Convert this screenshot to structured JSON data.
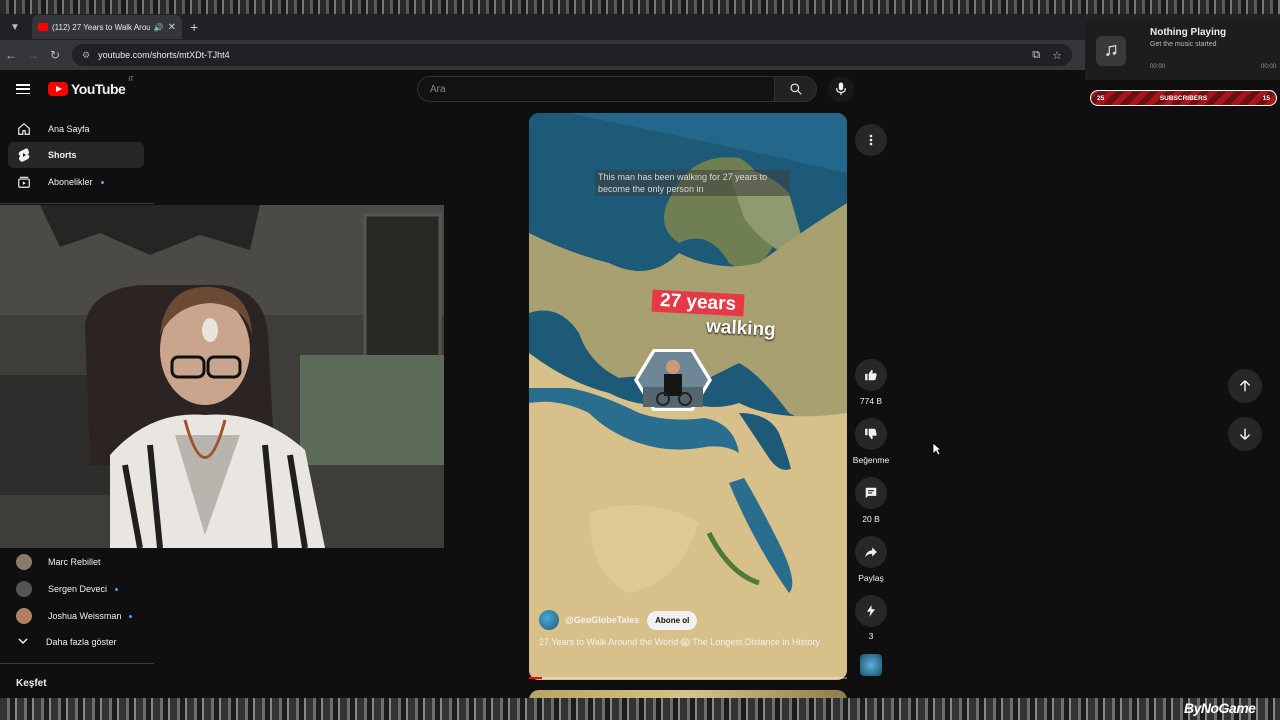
{
  "browser": {
    "tab_title": "(112) 27 Years to Walk Arou",
    "url": "youtube.com/shorts/mtXDt-TJht4"
  },
  "youtube": {
    "logo_text": "YouTube",
    "region": "IT",
    "search_placeholder": "Ara"
  },
  "sidebar": {
    "home": "Ana Sayfa",
    "shorts": "Shorts",
    "subscriptions": "Abonelikler",
    "subs": [
      {
        "name": "Marc Rebillet",
        "color": "#8a7a6a"
      },
      {
        "name": "Sergen Deveci",
        "color": "#555555"
      },
      {
        "name": "Joshua Weissman",
        "color": "#b08060"
      }
    ],
    "show_more": "Daha fazla göster",
    "explore": "Keşfet"
  },
  "short": {
    "caption": "This man has been walking for 27 years to become the only person in",
    "headline_1": "27 years",
    "headline_2": "walking",
    "channel": "@GeoGlobeTales",
    "subscribe": "Abone ol",
    "title": "27 Years to Walk Around the World 😱 The Longest Distance in History",
    "progress_percent": 4
  },
  "actions": {
    "likes": "774 B",
    "dislike": "Beğenme",
    "comments": "20 B",
    "share": "Paylaş",
    "remix": "3"
  },
  "overlay": {
    "np_title": "Nothing Playing",
    "np_sub": "Get the music started",
    "np_time_left": "00:00",
    "np_time_right": "00:00",
    "subs_left": "25",
    "subs_label": "SUBSCRIBERS",
    "subs_right": "15",
    "brand": "ByNoGame"
  },
  "colors": {
    "accent": "#ff0000",
    "blue_dot": "#3ea6ff"
  }
}
